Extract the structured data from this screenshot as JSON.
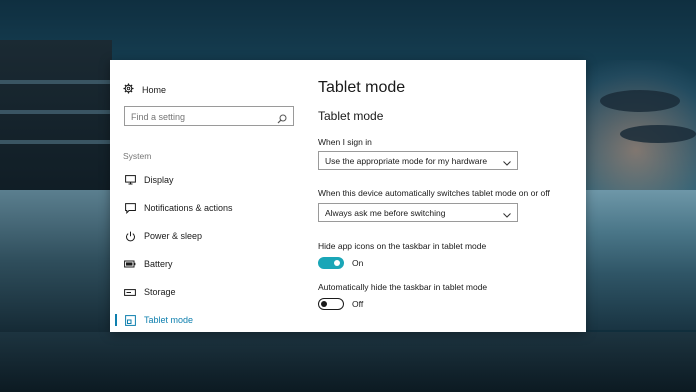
{
  "sidebar": {
    "home_label": "Home",
    "search_placeholder": "Find a setting",
    "section_title": "System",
    "items": [
      {
        "label": "Display",
        "icon": "monitor-icon"
      },
      {
        "label": "Notifications & actions",
        "icon": "notification-icon"
      },
      {
        "label": "Power & sleep",
        "icon": "power-icon"
      },
      {
        "label": "Battery",
        "icon": "battery-icon"
      },
      {
        "label": "Storage",
        "icon": "storage-icon"
      },
      {
        "label": "Tablet mode",
        "icon": "tablet-mode-icon",
        "active": true
      }
    ]
  },
  "content": {
    "page_title": "Tablet mode",
    "section_title": "Tablet mode",
    "sign_in_label": "When I sign in",
    "sign_in_value": "Use the appropriate mode for my hardware",
    "switch_label": "When this device automatically switches tablet mode on or off",
    "switch_value": "Always ask me before switching",
    "hide_icons_label": "Hide app icons on the taskbar in tablet mode",
    "hide_icons_state": "On",
    "hide_taskbar_label": "Automatically hide the taskbar in tablet mode",
    "hide_taskbar_state": "Off"
  },
  "colors": {
    "accent": "#0e7fae",
    "toggle_on": "#1aa6b7",
    "window_bg": "#ffffff"
  }
}
